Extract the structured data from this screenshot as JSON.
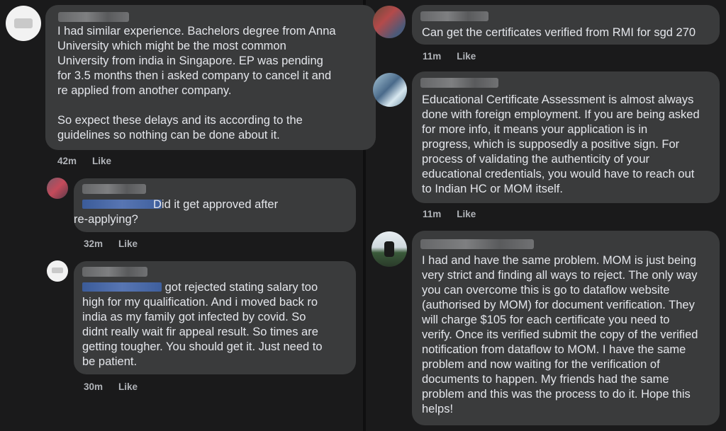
{
  "left": {
    "comments": [
      {
        "text": "I had similar experience. Bachelors degree from Anna\nUniversity which might be the most common\nUniversity from india in Singapore. EP was pending\nfor 3.5 months then i asked company to cancel it and\nre applied from another company.\n\nSo expect these delays and its according to the\nguidelines so nothing can be done about it.",
        "time": "42m",
        "like": "Like"
      },
      {
        "text": "Did it get approved after\nre-applying?",
        "time": "32m",
        "like": "Like"
      },
      {
        "text": " got rejected stating salary too\nhigh for my qualification. And i moved back ro\nindia as my family got infected by covid. So\ndidnt really wait fir appeal result. So times are\ngetting tougher. You should get it. Just need to\nbe patient.",
        "time": "30m",
        "like": "Like"
      }
    ]
  },
  "right": {
    "comments": [
      {
        "text": "Can get the certificates verified from RMI for sgd 270",
        "time": "11m",
        "like": "Like"
      },
      {
        "text": "Educational Certificate Assessment is almost always\ndone with foreign employment. If you are being asked\nfor more info, it means your application is in\nprogress, which is supposedly a positive sign. For\nprocess of validating the authenticity of your\neducational credentials, you would have to reach out\nto Indian HC or MOM itself.",
        "time": "11m",
        "like": "Like"
      },
      {
        "text": "I had and have the same problem. MOM is just being\nvery strict and finding all ways to reject. The only way\nyou can overcome this is go to dataflow website\n(authorised by MOM) for document verification. They\nwill charge $105 for each certificate you need to\nverify. Once its verified submit the copy of the verified\nnotification from dataflow to MOM. I have the same\nproblem and now waiting for the verification of\ndocuments to happen. My friends had the same\nproblem and this was the process to do it. Hope this\nhelps!",
        "time": "",
        "like": ""
      }
    ]
  },
  "colors": {
    "background": "#18191a",
    "bubble": "#3a3b3c",
    "text": "#e4e6eb",
    "meta": "#b0b3b8"
  }
}
